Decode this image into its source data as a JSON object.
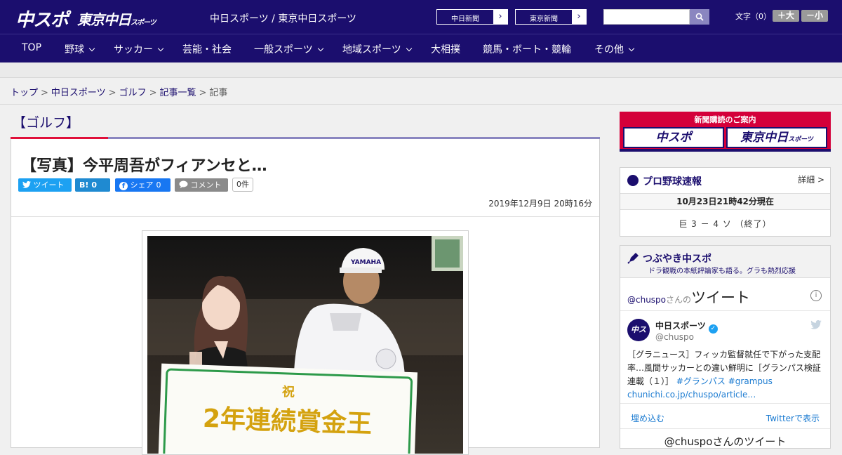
{
  "header": {
    "logo_chuspo": "中スポ",
    "logo_tokyo": "東京中日",
    "logo_tokyo_small": "スポーツ",
    "site_title": "中日スポーツ / 東京中日スポーツ",
    "btn_chunichi": "中日新聞",
    "btn_tokyo": "東京新聞",
    "font_label": "文字（0）",
    "font_up": "＋大",
    "font_down": "－小"
  },
  "nav": {
    "items": [
      "TOP",
      "野球",
      "サッカー",
      "芸能・社会",
      "一般スポーツ",
      "地域スポーツ",
      "大相撲",
      "競馬・ボート・競輪",
      "その他"
    ]
  },
  "breadcrumb": {
    "items": [
      "トップ",
      "中日スポーツ",
      "ゴルフ",
      "記事一覧"
    ],
    "current": "記事",
    "sep": ">"
  },
  "article": {
    "category": "【ゴルフ】",
    "title": "【写真】今平周吾がフィアンセと…",
    "share_tweet": "ツイート",
    "share_hatena": "B!",
    "share_hatena_count": "0",
    "share_fb": "シェア",
    "share_fb_count": "0",
    "share_comment": "コメント",
    "comment_count": "0件",
    "date": "2019年12月9日 20時16分",
    "photo_board_top": "祝",
    "photo_board_main": "2年連続賞金王",
    "photo_cap_brand": "YAMAHA"
  },
  "sidebar": {
    "sub_head": "新聞購読のご案内",
    "sub_chuspo": "中スポ",
    "sub_tokyo": "東京中日",
    "sub_tokyo_small": "スポーツ",
    "baseball_title": "プロ野球速報",
    "baseball_detail": "詳細 >",
    "baseball_time": "10月23日21時42分現在",
    "baseball_game": "巨 3 － 4 ソ （終了）",
    "tsubuyaki_title": "つぶやき中スポ",
    "tsubuyaki_sub": "ドラ観戦の本紙評論家も語る。グラも熱烈応援",
    "timeline_handle": "@chuspo",
    "timeline_san": "さんの",
    "timeline_tweet": "ツイート",
    "tweet_name": "中日スポーツ",
    "tweet_handle": "@chuspo",
    "avatar_text": "中スポ",
    "tweet_body": "［グラニュース］フィッカ監督就任で下がった支配率…風間サッカーとの違い鮮明に［グランパス検証連載（１）］",
    "tweet_tag1": "#グランパス",
    "tweet_tag2": "#grampus",
    "tweet_link": "chunichi.co.jp/chuspo/article…",
    "embed": "埋め込む",
    "view_on_twitter": "Twitterで表示",
    "footer": "@chuspoさんのツイート"
  },
  "colors": {
    "brand_navy": "#1b0e6e",
    "accent_red": "#e0103a",
    "twitter_blue": "#1da1f2"
  }
}
